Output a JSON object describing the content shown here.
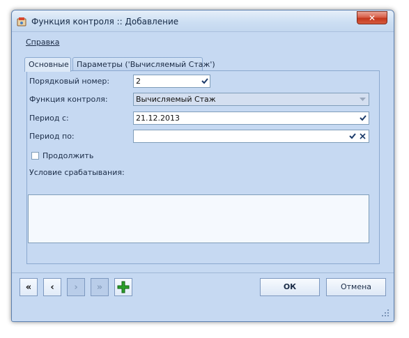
{
  "window": {
    "title": "Функция контроля :: Добавление",
    "close_symbol": "✕",
    "icon": "app-icon"
  },
  "menu": {
    "help": "Справка"
  },
  "tabs": [
    {
      "label": "Основные",
      "active": true
    },
    {
      "label": "Параметры ('Вычисляемый Стаж')",
      "active": false
    }
  ],
  "form": {
    "order_label": "Порядковый номер:",
    "order_value": "2",
    "function_label": "Функция контроля:",
    "function_value": "Вычисляемый Стаж",
    "period_from_label": "Период с:",
    "period_from_value": "21.12.2013",
    "period_to_label": "Период по:",
    "period_to_value": "",
    "continue_label": "Продолжить",
    "continue_checked": false,
    "condition_label": "Условие срабатывания:",
    "condition_value": ""
  },
  "nav": {
    "first": "«",
    "prev": "‹",
    "next": "›",
    "last": "»",
    "add": "+"
  },
  "buttons": {
    "ok": "ОК",
    "cancel": "Отмена"
  },
  "colors": {
    "window_bg": "#c6d9f2",
    "add_green": "#2aa02a",
    "close_red": "#c3381e"
  }
}
